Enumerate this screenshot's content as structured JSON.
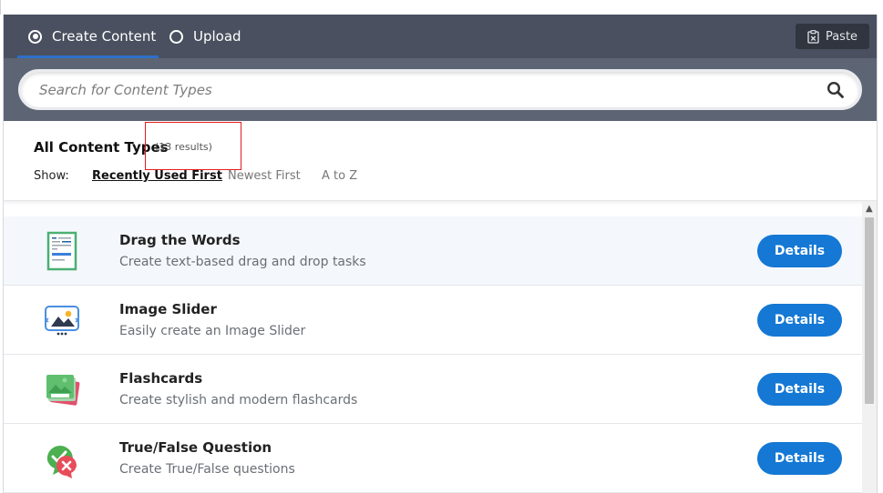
{
  "tabs": {
    "create_label": "Create Content",
    "upload_label": "Upload",
    "active": "create"
  },
  "toolbar": {
    "paste_label": "Paste"
  },
  "search": {
    "placeholder": "Search for Content Types"
  },
  "results": {
    "heading": "All Content Types",
    "count_text": "(13 results)",
    "show_label": "Show:",
    "sort_options": [
      "Recently Used First",
      "Newest First",
      "A to Z"
    ],
    "active_sort": "Recently Used First"
  },
  "content_types": [
    {
      "title": "Drag the Words",
      "description": "Create text-based drag and drop tasks",
      "button": "Details",
      "icon": "drag-words-icon"
    },
    {
      "title": "Image Slider",
      "description": "Easily create an Image Slider",
      "button": "Details",
      "icon": "image-slider-icon"
    },
    {
      "title": "Flashcards",
      "description": "Create stylish and modern flashcards",
      "button": "Details",
      "icon": "flashcards-icon"
    },
    {
      "title": "True/False Question",
      "description": "Create True/False questions",
      "button": "Details",
      "icon": "true-false-icon"
    }
  ],
  "colors": {
    "tab_bar": "#4a505f",
    "search_band": "#5d6575",
    "accent": "#1478d4",
    "highlight_box": "#e31c1c"
  }
}
